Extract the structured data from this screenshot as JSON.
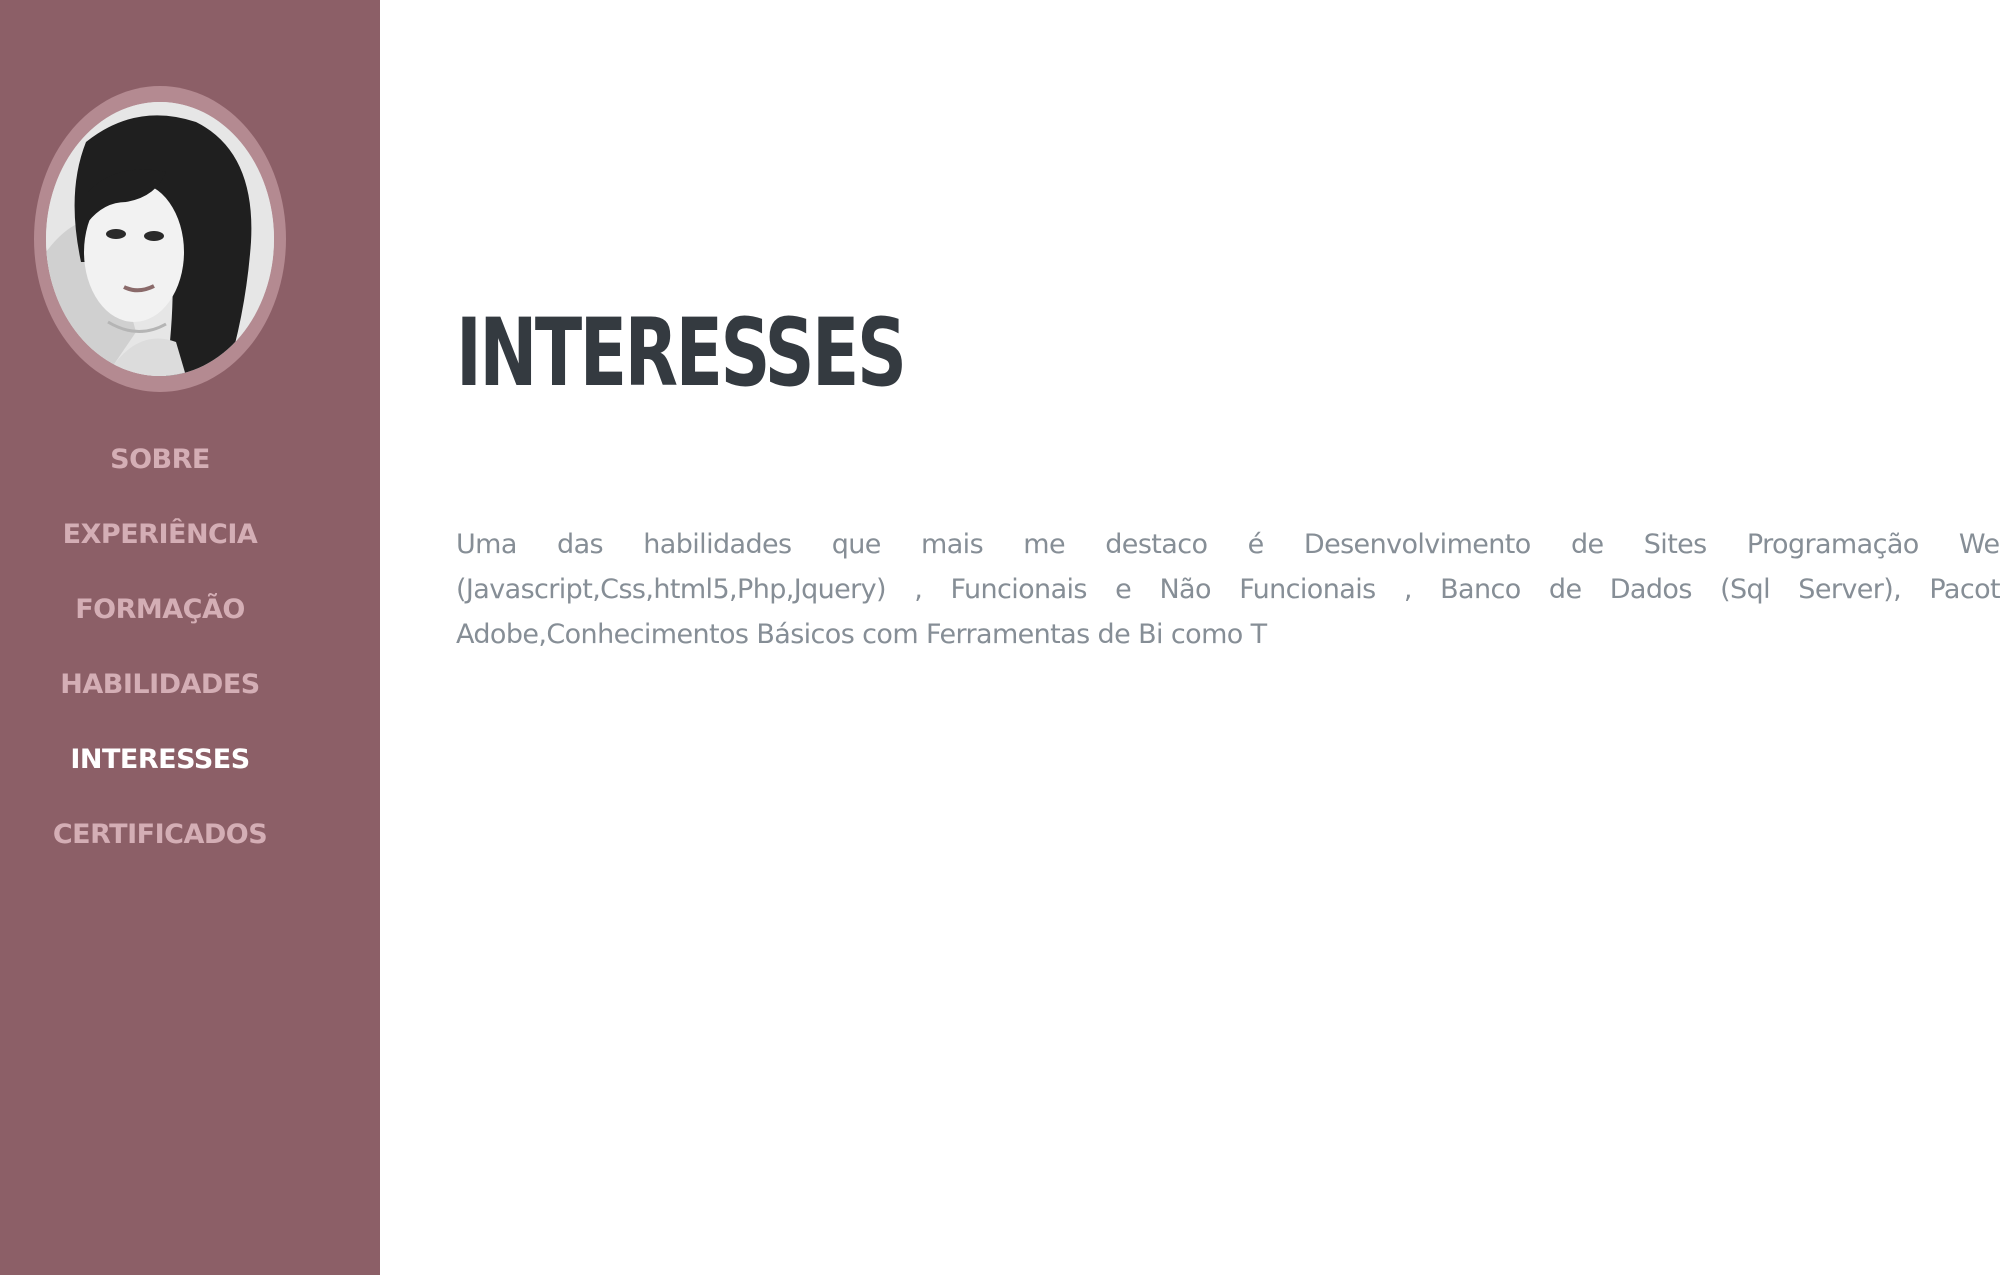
{
  "sidebar": {
    "nav": [
      {
        "label": "SOBRE",
        "active": false
      },
      {
        "label": "EXPERIÊNCIA",
        "active": false
      },
      {
        "label": "FORMAÇÃO",
        "active": false
      },
      {
        "label": "HABILIDADES",
        "active": false
      },
      {
        "label": "INTERESSES",
        "active": true
      },
      {
        "label": "CERTIFICADOS",
        "active": false
      }
    ]
  },
  "main": {
    "title": "INTERESSES",
    "text": "Uma das habilidades que mais me destaco é Desenvolvimento de Sites Programação Web (Javascript,Css,html5,Php,Jquery) , Funcionais e Não Funcionais , Banco de Dados (Sql Server), Pacote Adobe,Conhecimentos Básicos com Ferramentas de Bi como T"
  },
  "colors": {
    "sidebar": "#8c5f67",
    "nav_text": "#d4aeb5",
    "nav_active": "#ffffff",
    "title": "#343a40",
    "body_text": "#868e96"
  }
}
